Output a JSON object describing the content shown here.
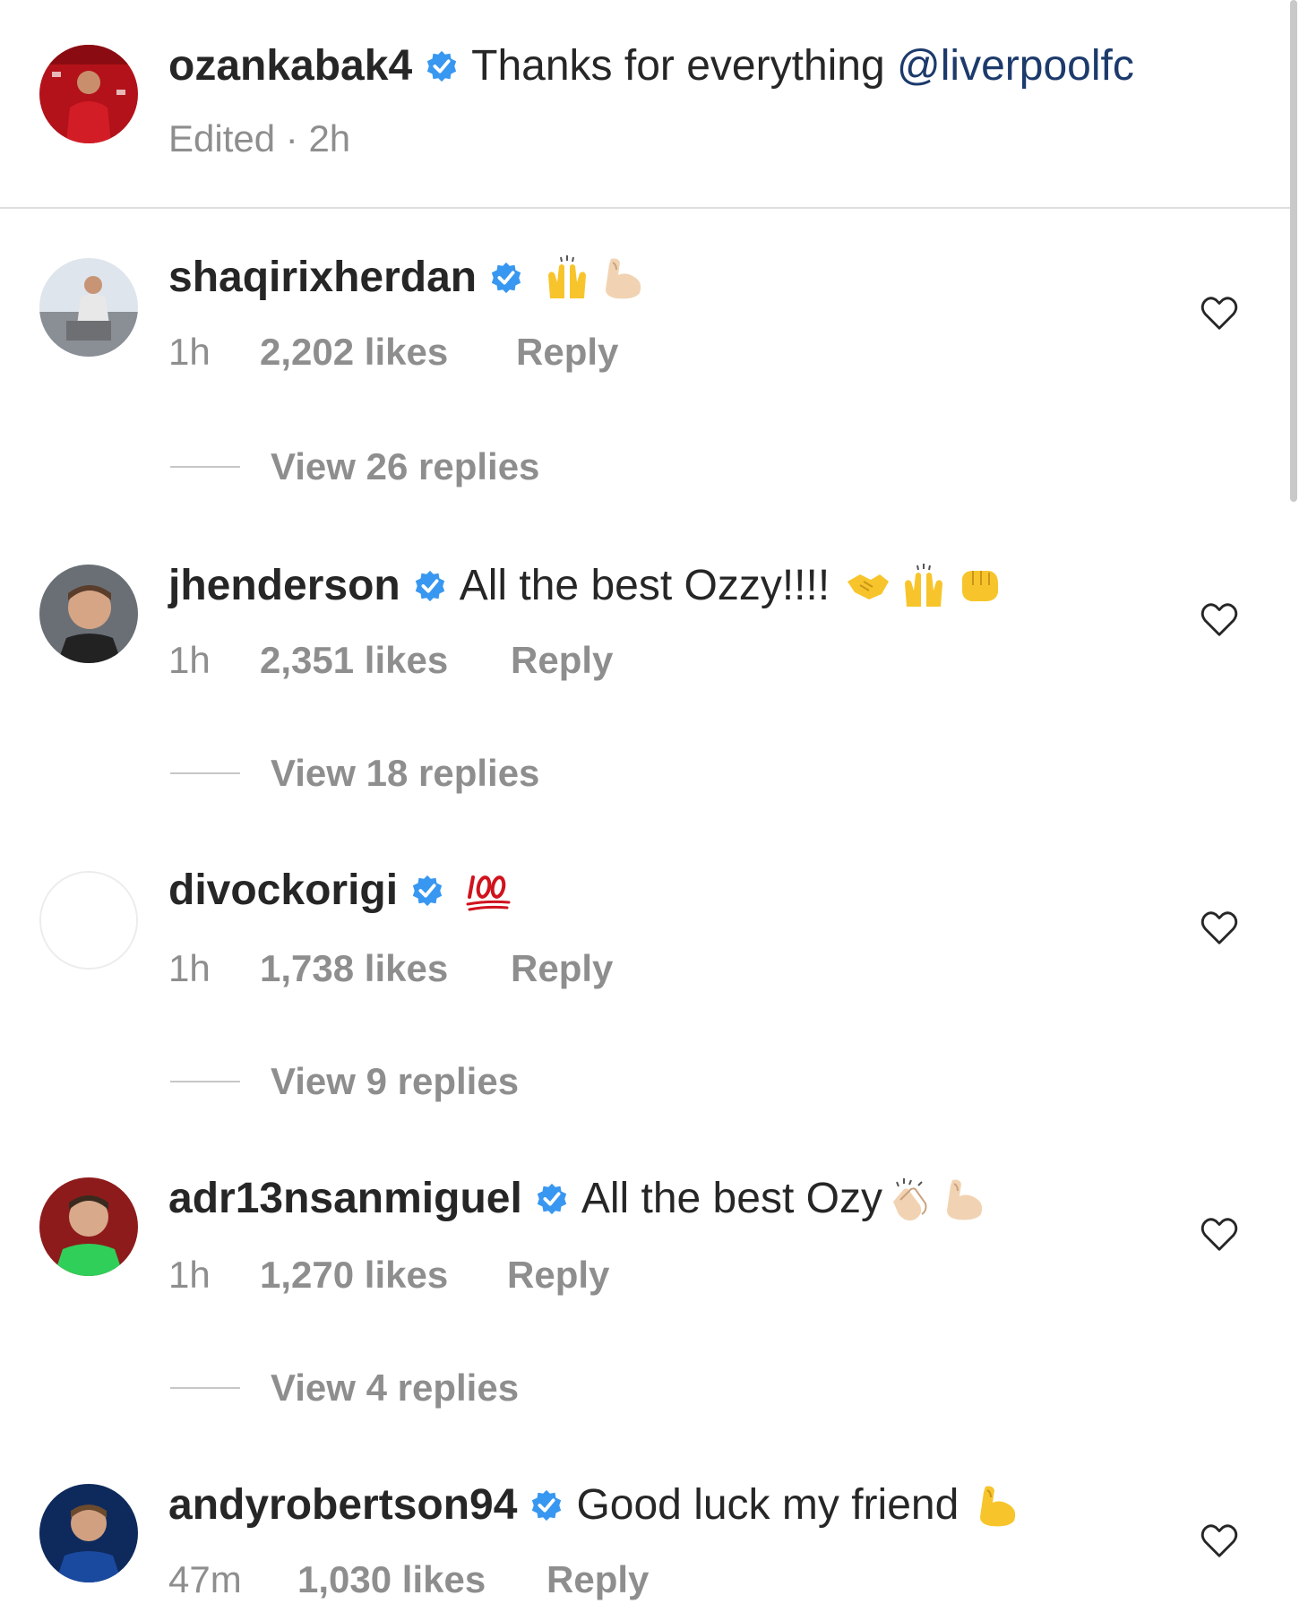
{
  "caption": {
    "username": "ozankabak4",
    "text": "Thanks for everything ",
    "mention": "@liverpoolfc",
    "edited": "Edited",
    "separator": "·",
    "time": "2h"
  },
  "comments": [
    {
      "username": "shaqirixherdan",
      "text": "",
      "emojis": [
        "raising-hands-emoji",
        "flexed-biceps-emoji"
      ],
      "time": "1h",
      "likes": "2,202 likes",
      "reply": "Reply",
      "view_replies": "View 26 replies"
    },
    {
      "username": "jhenderson",
      "text": "All the best Ozzy!!!!",
      "emojis": [
        "handshake-emoji",
        "raising-hands-emoji",
        "fist-bump-emoji"
      ],
      "time": "1h",
      "likes": "2,351 likes",
      "reply": "Reply",
      "view_replies": "View 18 replies"
    },
    {
      "username": "divockorigi",
      "text": "",
      "emojis": [
        "hundred-points-emoji"
      ],
      "time": "1h",
      "likes": "1,738 likes",
      "reply": "Reply",
      "view_replies": "View 9 replies"
    },
    {
      "username": "adr13nsanmiguel",
      "text": "All the best Ozy",
      "emojis": [
        "clapping-hands-emoji",
        "flexed-biceps-emoji"
      ],
      "time": "1h",
      "likes": "1,270 likes",
      "reply": "Reply",
      "view_replies": "View 4 replies"
    },
    {
      "username": "andyrobertson94",
      "text": "Good luck my friend",
      "emojis": [
        "flexed-biceps-emoji"
      ],
      "time": "47m",
      "likes": "1,030 likes",
      "reply": "Reply"
    }
  ],
  "colors": {
    "verified_blue": "#3897f0",
    "meta_gray": "#8e8e8e",
    "text_dark": "#262626",
    "mention_navy": "#1c3a6b"
  }
}
